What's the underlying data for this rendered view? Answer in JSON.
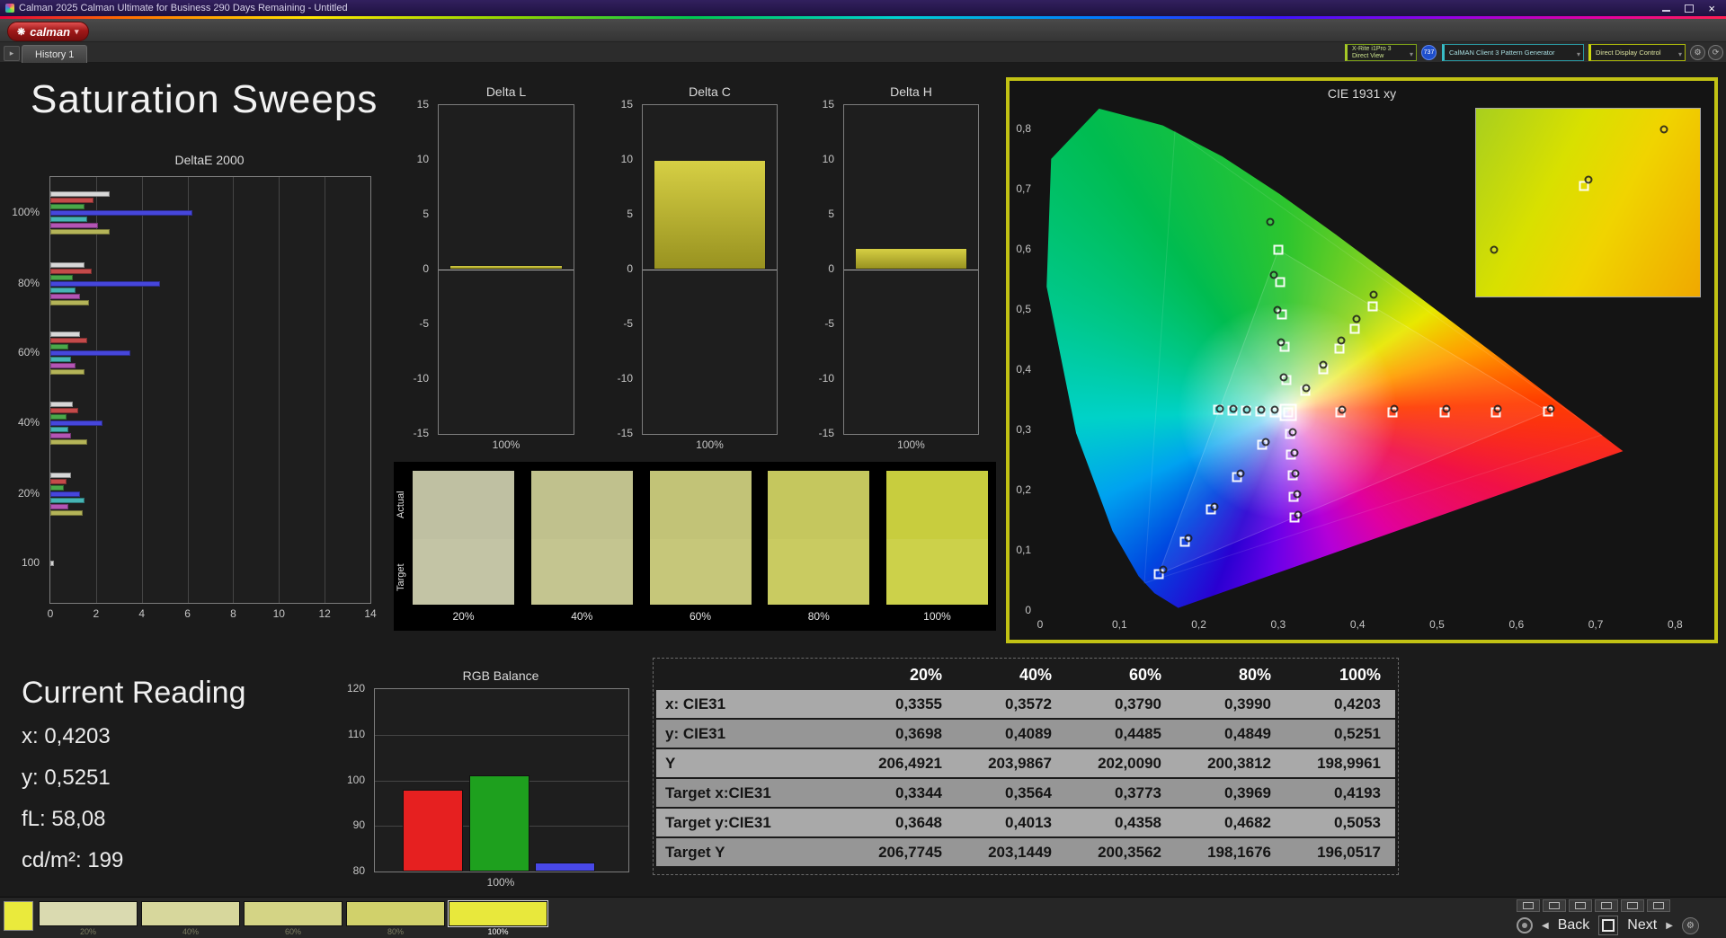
{
  "window": {
    "title": "Calman 2025 Calman Ultimate for Business 290 Days Remaining - Untitled",
    "close_icon": "×"
  },
  "icons": {
    "logo_mark": "❋",
    "caret": "▾",
    "tab_arrow": "▸",
    "gear": "⚙",
    "refresh": "⟳",
    "back_arrow": "◀",
    "next_arrow": "▶"
  },
  "toolbar": {
    "logo_label": "calman"
  },
  "tabs": {
    "active": "History 1"
  },
  "devicebar": {
    "meter_line1": "X-Rite i1Pro 3",
    "meter_line2": "Direct View",
    "badge": "737",
    "source": "CalMAN Client 3 Pattern Generator",
    "display": "Direct Display Control"
  },
  "page": {
    "title": "Saturation Sweeps"
  },
  "current_reading": {
    "title": "Current Reading",
    "lines": [
      "x: 0,4203",
      "y: 0,5251",
      "fL: 58,08",
      "cd/m²: 199"
    ]
  },
  "table": {
    "columns": [
      "20%",
      "40%",
      "60%",
      "80%",
      "100%"
    ],
    "rows": [
      {
        "label": "x: CIE31",
        "values": [
          "0,3355",
          "0,3572",
          "0,3790",
          "0,3990",
          "0,4203"
        ]
      },
      {
        "label": "y: CIE31",
        "values": [
          "0,3698",
          "0,4089",
          "0,4485",
          "0,4849",
          "0,5251"
        ]
      },
      {
        "label": "Y",
        "values": [
          "206,4921",
          "203,9867",
          "202,0090",
          "200,3812",
          "198,9961"
        ]
      },
      {
        "label": "Target x:CIE31",
        "values": [
          "0,3344",
          "0,3564",
          "0,3773",
          "0,3969",
          "0,4193"
        ]
      },
      {
        "label": "Target y:CIE31",
        "values": [
          "0,3648",
          "0,4013",
          "0,4358",
          "0,4682",
          "0,5053"
        ]
      },
      {
        "label": "Target Y",
        "values": [
          "206,7745",
          "203,1449",
          "200,3562",
          "198,1676",
          "196,0517"
        ]
      }
    ]
  },
  "bottom": {
    "patches": [
      {
        "label": "20%",
        "color": "#dadab0"
      },
      {
        "label": "40%",
        "color": "#d7d79c"
      },
      {
        "label": "60%",
        "color": "#d4d485"
      },
      {
        "label": "80%",
        "color": "#d1d16b"
      },
      {
        "label": "100%",
        "color": "#e8e83c",
        "selected": true
      }
    ],
    "back_label": "Back",
    "next_label": "Next"
  },
  "chart_data": {
    "deltae": {
      "type": "bar",
      "title": "DeltaE 2000",
      "xticks": [
        0,
        2,
        4,
        6,
        8,
        10,
        12,
        14
      ],
      "xlim": [
        0,
        14
      ],
      "groups": [
        {
          "label": "100%",
          "bars": [
            {
              "color": "#d8d8d8",
              "value": 2.6
            },
            {
              "color": "#c44a4a",
              "value": 1.9
            },
            {
              "color": "#4aa84a",
              "value": 1.5
            },
            {
              "color": "#4646dc",
              "value": 6.2
            },
            {
              "color": "#46b4b4",
              "value": 1.6
            },
            {
              "color": "#b455b4",
              "value": 2.1
            },
            {
              "color": "#b4b458",
              "value": 2.6
            }
          ]
        },
        {
          "label": "80%",
          "bars": [
            {
              "color": "#d8d8d8",
              "value": 1.5
            },
            {
              "color": "#c44a4a",
              "value": 1.8
            },
            {
              "color": "#4aa84a",
              "value": 1.0
            },
            {
              "color": "#4646dc",
              "value": 4.8
            },
            {
              "color": "#46b4b4",
              "value": 1.1
            },
            {
              "color": "#b455b4",
              "value": 1.3
            },
            {
              "color": "#b4b458",
              "value": 1.7
            }
          ]
        },
        {
          "label": "60%",
          "bars": [
            {
              "color": "#d8d8d8",
              "value": 1.3
            },
            {
              "color": "#c44a4a",
              "value": 1.6
            },
            {
              "color": "#4aa84a",
              "value": 0.8
            },
            {
              "color": "#4646dc",
              "value": 3.5
            },
            {
              "color": "#46b4b4",
              "value": 0.9
            },
            {
              "color": "#b455b4",
              "value": 1.1
            },
            {
              "color": "#b4b458",
              "value": 1.5
            }
          ]
        },
        {
          "label": "40%",
          "bars": [
            {
              "color": "#d8d8d8",
              "value": 1.0
            },
            {
              "color": "#c44a4a",
              "value": 1.2
            },
            {
              "color": "#4aa84a",
              "value": 0.7
            },
            {
              "color": "#4646dc",
              "value": 2.3
            },
            {
              "color": "#46b4b4",
              "value": 0.8
            },
            {
              "color": "#b455b4",
              "value": 0.9
            },
            {
              "color": "#b4b458",
              "value": 1.6
            }
          ]
        },
        {
          "label": "20%",
          "bars": [
            {
              "color": "#d8d8d8",
              "value": 0.9
            },
            {
              "color": "#c44a4a",
              "value": 0.7
            },
            {
              "color": "#4aa84a",
              "value": 0.6
            },
            {
              "color": "#4646dc",
              "value": 1.3
            },
            {
              "color": "#46b4b4",
              "value": 1.5
            },
            {
              "color": "#b455b4",
              "value": 0.8
            },
            {
              "color": "#b4b458",
              "value": 1.4
            }
          ]
        },
        {
          "label": "100",
          "bars": [
            {
              "color": "#d8d8d8",
              "value": 0.15
            }
          ]
        }
      ]
    },
    "delta_l": {
      "type": "bar",
      "title": "Delta L",
      "value": 0.4,
      "yticks": [
        "15",
        "10",
        "5",
        "0",
        "-5",
        "-10",
        "-15"
      ],
      "ylim": [
        -15,
        15
      ],
      "xlabel": "100%"
    },
    "delta_c": {
      "type": "bar",
      "title": "Delta C",
      "value": 10,
      "yticks": [
        "15",
        "10",
        "5",
        "0",
        "-5",
        "-10",
        "-15"
      ],
      "ylim": [
        -15,
        15
      ],
      "xlabel": "100%"
    },
    "delta_h": {
      "type": "bar",
      "title": "Delta H",
      "value": 2,
      "yticks": [
        "15",
        "10",
        "5",
        "0",
        "-5",
        "-10",
        "-15"
      ],
      "ylim": [
        -15,
        15
      ],
      "xlabel": "100%"
    },
    "swatch_compare": {
      "actual_label": "Actual",
      "target_label": "Target",
      "columns": [
        {
          "label": "20%",
          "actual": "#bfc0a2",
          "target": "#c3c4a5"
        },
        {
          "label": "40%",
          "actual": "#c0c18d",
          "target": "#c4c590"
        },
        {
          "label": "60%",
          "actual": "#c2c377",
          "target": "#c6c77a"
        },
        {
          "label": "80%",
          "actual": "#c5c75e",
          "target": "#c9cb61"
        },
        {
          "label": "100%",
          "actual": "#c8cd3e",
          "target": "#ccd14a"
        }
      ]
    },
    "cie": {
      "type": "scatter",
      "title": "CIE 1931 xy",
      "xticks": [
        "0",
        "0,1",
        "0,2",
        "0,3",
        "0,4",
        "0,5",
        "0,6",
        "0,7",
        "0,8"
      ],
      "yticks": [
        "0",
        "0,1",
        "0,2",
        "0,3",
        "0,4",
        "0,5",
        "0,6",
        "0,7",
        "0,8"
      ],
      "white_point": [
        0.3127,
        0.329
      ],
      "sweeps": {
        "red": {
          "targets": [
            [
              0.3782,
              0.329
            ],
            [
              0.4436,
              0.3293
            ],
            [
              0.5091,
              0.3295
            ],
            [
              0.5745,
              0.3297
            ],
            [
              0.64,
              0.33
            ]
          ],
          "measured": [
            [
              0.38,
              0.334
            ],
            [
              0.446,
              0.3345
            ],
            [
              0.512,
              0.335
            ],
            [
              0.577,
              0.335
            ],
            [
              0.643,
              0.3355
            ]
          ]
        },
        "green": {
          "targets": [
            [
              0.3102,
              0.3832
            ],
            [
              0.3076,
              0.4374
            ],
            [
              0.3051,
              0.4916
            ],
            [
              0.3025,
              0.5458
            ],
            [
              0.3,
              0.6
            ]
          ],
          "measured": [
            [
              0.307,
              0.388
            ],
            [
              0.303,
              0.445
            ],
            [
              0.299,
              0.5
            ],
            [
              0.295,
              0.558
            ],
            [
              0.29,
              0.645
            ]
          ]
        },
        "blue": {
          "targets": [
            [
              0.2802,
              0.2752
            ],
            [
              0.2476,
              0.2214
            ],
            [
              0.2151,
              0.1676
            ],
            [
              0.1825,
              0.1138
            ],
            [
              0.15,
              0.06
            ]
          ],
          "measured": [
            [
              0.284,
              0.28
            ],
            [
              0.252,
              0.227
            ],
            [
              0.22,
              0.173
            ],
            [
              0.187,
              0.12
            ],
            [
              0.155,
              0.068
            ]
          ]
        },
        "cyan": {
          "targets": [
            [
              0.2951,
              0.3298
            ],
            [
              0.2775,
              0.3306
            ],
            [
              0.2599,
              0.3314
            ],
            [
              0.2422,
              0.3321
            ],
            [
              0.2246,
              0.3329
            ]
          ],
          "measured": [
            [
              0.296,
              0.333
            ],
            [
              0.279,
              0.3335
            ],
            [
              0.261,
              0.334
            ],
            [
              0.244,
              0.3345
            ],
            [
              0.226,
              0.335
            ]
          ]
        },
        "magenta": {
          "targets": [
            [
              0.3144,
              0.294
            ],
            [
              0.316,
              0.2591
            ],
            [
              0.3177,
              0.2241
            ],
            [
              0.3193,
              0.1892
            ],
            [
              0.321,
              0.1542
            ]
          ],
          "measured": [
            [
              0.318,
              0.296
            ],
            [
              0.32,
              0.262
            ],
            [
              0.322,
              0.228
            ],
            [
              0.3235,
              0.193
            ],
            [
              0.325,
              0.159
            ]
          ]
        },
        "yellow": {
          "targets": [
            [
              0.3344,
              0.3648
            ],
            [
              0.3564,
              0.4013
            ],
            [
              0.3773,
              0.4358
            ],
            [
              0.3969,
              0.4682
            ],
            [
              0.4193,
              0.5053
            ]
          ],
          "measured": [
            [
              0.3355,
              0.3698
            ],
            [
              0.3572,
              0.4089
            ],
            [
              0.379,
              0.4485
            ],
            [
              0.399,
              0.4849
            ],
            [
              0.4203,
              0.5251
            ]
          ]
        }
      }
    },
    "rgb_balance": {
      "type": "bar",
      "title": "RGB Balance",
      "categories": [
        "Red",
        "Green",
        "Blue"
      ],
      "values": [
        98,
        101,
        82
      ],
      "colors": [
        "#e62020",
        "#1ea01e",
        "#4848e8"
      ],
      "yticks": [
        "120",
        "110",
        "100",
        "90",
        "80"
      ],
      "ylim": [
        80,
        120
      ],
      "xlabel": "100%"
    }
  }
}
